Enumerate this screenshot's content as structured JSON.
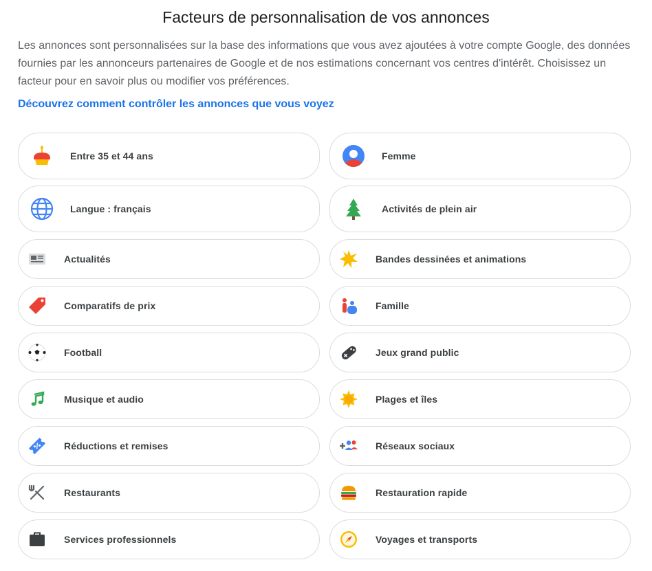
{
  "header": {
    "title": "Facteurs de personnalisation de vos annonces",
    "description": "Les annonces sont personnalisées sur la base des informations que vous avez ajoutées à votre compte Google, des données fournies par les annonceurs partenaires de Google et de nos estimations concernant vos centres d'intérêt. Choisissez un facteur pour en savoir plus ou modifier vos préférences.",
    "link": "Découvrez comment contrôler les annonces que vous voyez"
  },
  "factors": [
    {
      "label": "Entre 35 et 44 ans",
      "icon": "birthday-cake-icon"
    },
    {
      "label": "Femme",
      "icon": "person-avatar-icon"
    },
    {
      "label": "Langue : français",
      "icon": "globe-icon"
    },
    {
      "label": "Activités de plein air",
      "icon": "pine-tree-icon"
    },
    {
      "label": "Actualités",
      "icon": "newspaper-icon"
    },
    {
      "label": "Bandes dessinées et animations",
      "icon": "comic-burst-icon"
    },
    {
      "label": "Comparatifs de prix",
      "icon": "price-tag-icon"
    },
    {
      "label": "Famille",
      "icon": "family-icon"
    },
    {
      "label": "Football",
      "icon": "soccer-ball-icon"
    },
    {
      "label": "Jeux grand public",
      "icon": "gamepad-icon"
    },
    {
      "label": "Musique et audio",
      "icon": "music-note-icon"
    },
    {
      "label": "Plages et îles",
      "icon": "sun-icon"
    },
    {
      "label": "Réductions et remises",
      "icon": "discount-ticket-icon"
    },
    {
      "label": "Réseaux sociaux",
      "icon": "add-people-icon"
    },
    {
      "label": "Restaurants",
      "icon": "fork-knife-icon"
    },
    {
      "label": "Restauration rapide",
      "icon": "hamburger-icon"
    },
    {
      "label": "Services professionnels",
      "icon": "briefcase-icon"
    },
    {
      "label": "Voyages et transports",
      "icon": "compass-icon"
    }
  ]
}
